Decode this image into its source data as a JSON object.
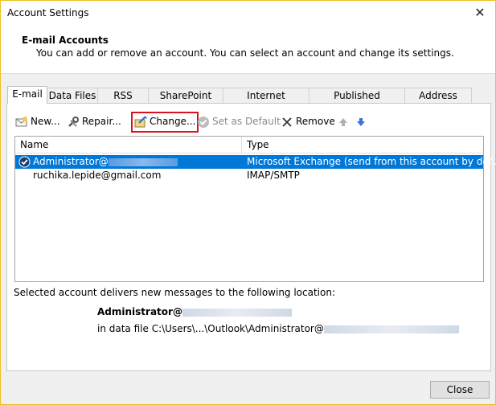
{
  "window": {
    "title": "Account Settings",
    "close_glyph": "✕"
  },
  "header": {
    "title": "E-mail Accounts",
    "subtitle": "You can add or remove an account. You can select an account and change its settings."
  },
  "tabs": [
    {
      "label": "E-mail",
      "active": true
    },
    {
      "label": "Data Files"
    },
    {
      "label": "RSS Feeds"
    },
    {
      "label": "SharePoint Lists"
    },
    {
      "label": "Internet Calendars"
    },
    {
      "label": "Published Calendars"
    },
    {
      "label": "Address Books"
    }
  ],
  "toolbar": {
    "new": "New...",
    "repair": "Repair...",
    "change": "Change...",
    "set_default": "Set as Default",
    "remove": "Remove",
    "move_up_icon": "arrow-up-icon",
    "move_down_icon": "arrow-down-icon",
    "highlight_color": "#d8141c"
  },
  "accounts": {
    "columns": {
      "name": "Name",
      "type": "Type"
    },
    "rows": [
      {
        "name": "Administrator@",
        "type": "Microsoft Exchange (send from this account by def...",
        "selected": true,
        "default": true
      },
      {
        "name": "ruchika.lepide@gmail.com",
        "type": "IMAP/SMTP",
        "selected": false,
        "default": false
      }
    ],
    "selection_color": "#0078d7"
  },
  "delivery": {
    "label": "Selected account delivers new messages to the following location:",
    "account": "Administrator@",
    "file": "in data file C:\\Users\\...\\Outlook\\Administrator@"
  },
  "footer": {
    "close_label": "Close"
  }
}
